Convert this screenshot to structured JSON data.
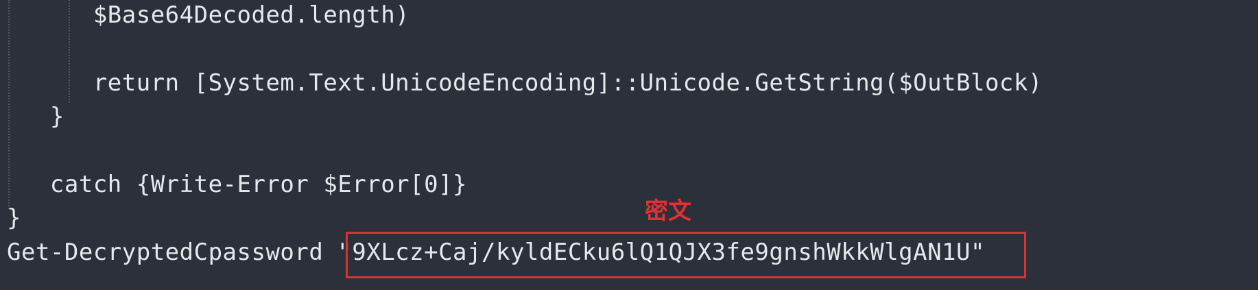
{
  "code": {
    "lines": [
      "      $Base64Decoded.length)",
      "",
      "      return [System.Text.UnicodeEncoding]::Unicode.GetString($OutBlock)",
      "   }",
      "",
      "   catch {Write-Error $Error[0]}",
      "}",
      "Get-DecryptedCpassword \"9XLcz+Caj/kyldECku6lQ1QJX3fe9gnshWkkWlgAN1U\""
    ]
  },
  "annotation": {
    "label": "密文"
  },
  "colors": {
    "background": "#2b303b",
    "text": "#e6e8ec",
    "highlight": "#d93232"
  }
}
